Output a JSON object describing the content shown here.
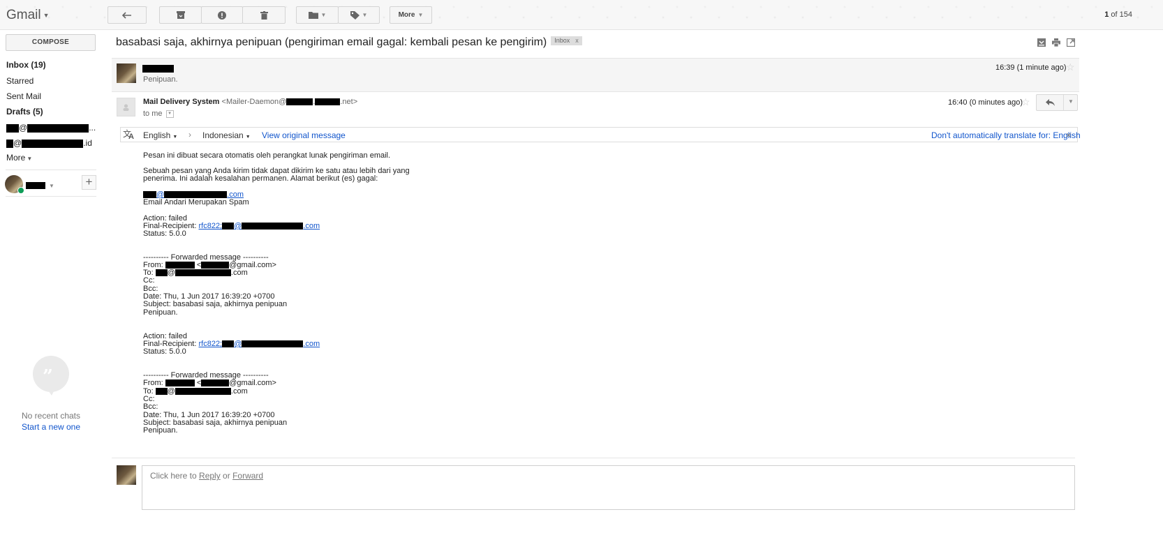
{
  "app": {
    "logo": "Gmail"
  },
  "toolbar": {
    "more_label": "More",
    "page_count_bold": "1",
    "page_count_rest": " of 154"
  },
  "nav": {
    "compose": "COMPOSE",
    "items": [
      "Inbox (19)",
      "Starred",
      "Sent Mail",
      "Drafts (5)"
    ],
    "account1_suffix": "...",
    "account2_suffix": ".id",
    "more": "More"
  },
  "chat": {
    "no_recent": "No recent chats",
    "start_new": "Start a new one"
  },
  "thread": {
    "subject": "basabasi saja, akhirnya penipuan (pengiriman email gagal: kembali pesan ke pengirim)",
    "label": "Inbox",
    "label_close": "x"
  },
  "message1": {
    "snippet": "Penipuan.",
    "time": "16:39 (1 minute ago)"
  },
  "message2": {
    "sender_name": "Mail Delivery System",
    "sender_email_prefix": "<Mailer-Daemon@",
    "sender_email_suffix": ".net>",
    "to": "to me",
    "time": "16:40 (0 minutes ago)"
  },
  "translate": {
    "from_lang": "English",
    "to_lang": "Indonesian",
    "view_original": "View original message",
    "dont_translate": "Don't automatically translate for: English",
    "close": "×"
  },
  "body": {
    "p1": "Pesan ini dibuat secara otomatis oleh perangkat lunak pengiriman email.",
    "p2a": "Sebuah pesan yang Anda kirim tidak dapat dikirim ke satu atau lebih dari yang",
    "p2b": "penerima. Ini adalah kesalahan permanen. Alamat berikut (es) gagal:",
    "addr_domain": ".com",
    "spam_line": "Email Andari Merupakan Spam",
    "action": "Action: failed",
    "final_recipient": "Final-Recipient: ",
    "rfc": "rfc822;",
    "status": "Status: 5.0.0",
    "fwd_header": "---------- Forwarded message ----------",
    "from": "From: ",
    "from_gmail": "@gmail.com>",
    "to": "To: ",
    "cc": "Cc:",
    "bcc": "Bcc:",
    "date": "Date: Thu, 1 Jun 2017 16:39:20 +0700",
    "subject": "Subject: basabasi saja, akhirnya penipuan",
    "closing": "Penipuan."
  },
  "reply": {
    "prefix": "Click here to ",
    "reply": "Reply",
    "or": " or ",
    "forward": "Forward"
  },
  "colors": {
    "link": "#1155cc",
    "online": "#0f9d58"
  }
}
